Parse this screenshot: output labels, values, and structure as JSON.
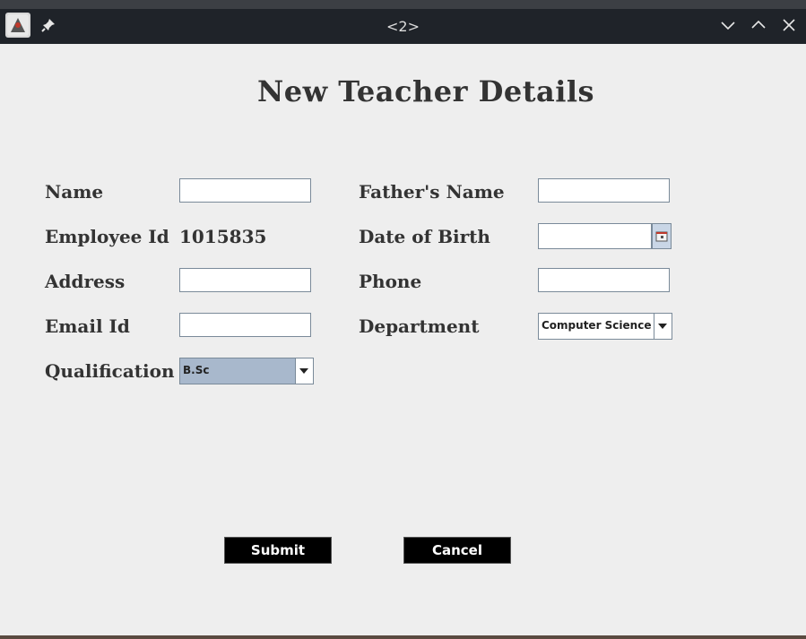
{
  "window": {
    "title": "<2>",
    "app_icon": "java-app-icon",
    "controls": [
      "pin-icon",
      "minimize-icon",
      "maximize-icon",
      "close-icon"
    ]
  },
  "form": {
    "heading": "New Teacher Details",
    "name_label": "Name",
    "name_value": "",
    "employee_id_label": "Employee Id",
    "employee_id_value": "1015835",
    "address_label": "Address",
    "address_value": "",
    "email_label": "Email Id",
    "email_value": "",
    "qualification_label": "Qualification",
    "qualification_selected": "B.Sc",
    "fathers_name_label": "Father's Name",
    "fathers_name_value": "",
    "dob_label": "Date of Birth",
    "dob_value": "",
    "phone_label": "Phone",
    "phone_value": "",
    "department_label": "Department",
    "department_selected": "Computer Science",
    "submit_label": "Submit",
    "cancel_label": "Cancel"
  },
  "colors": {
    "titlebar": "#1f2329",
    "client_background": "#eeeeee",
    "selected_combo": "#a8b8cc",
    "button_background": "#000000"
  }
}
